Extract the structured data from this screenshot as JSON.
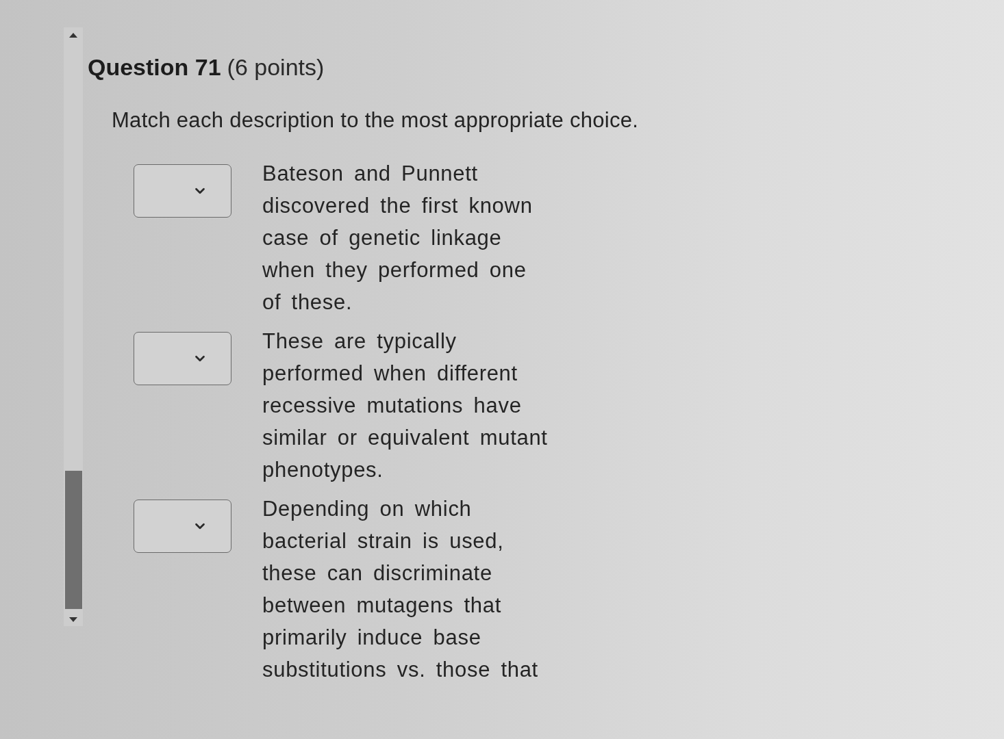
{
  "question": {
    "title": "Question 71",
    "points": "(6 points)",
    "prompt": "Match each description to the most appropriate choice."
  },
  "matches": [
    {
      "description": "Bateson and Punnett discovered the first known case of genetic linkage when they performed one of these."
    },
    {
      "description": "These are typically performed when different recessive mutations have similar or equivalent mutant phenotypes."
    },
    {
      "description": "Depending on which bacterial strain is used, these can discriminate between mutagens that primarily induce base substitutions vs. those that"
    }
  ]
}
